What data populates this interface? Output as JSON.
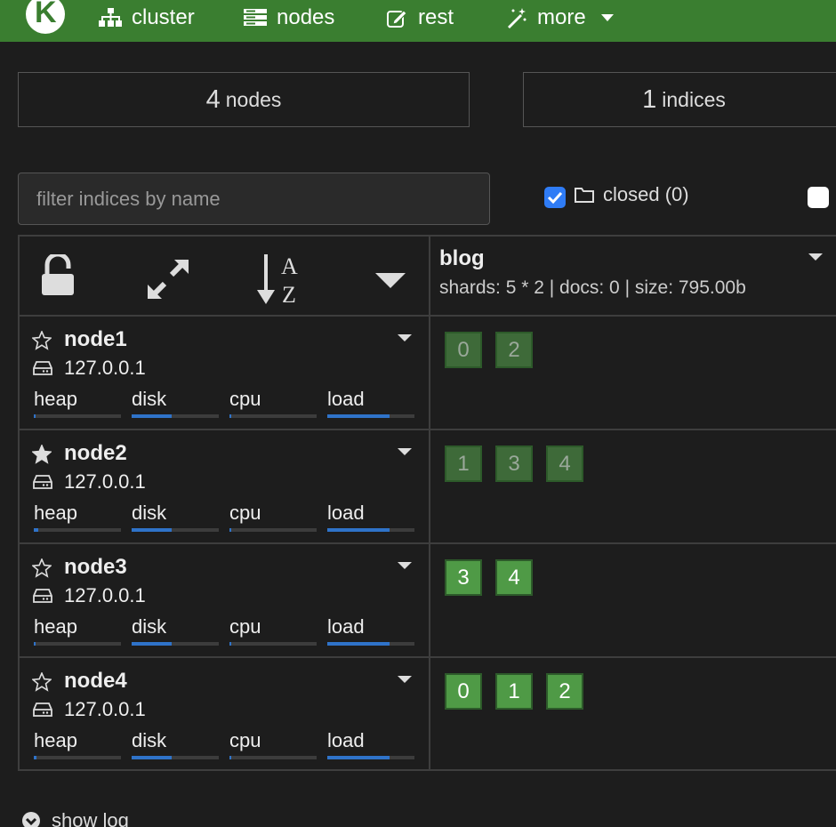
{
  "nav": {
    "logo_letter": "K",
    "items": [
      {
        "label": "cluster",
        "icon": "sitemap-icon"
      },
      {
        "label": "nodes",
        "icon": "server-icon"
      },
      {
        "label": "rest",
        "icon": "edit-icon"
      },
      {
        "label": "more",
        "icon": "magic-wand-icon"
      }
    ]
  },
  "summary": {
    "nodes": {
      "count": "4",
      "label": "nodes"
    },
    "indices": {
      "count": "1",
      "label": "indices"
    }
  },
  "filter": {
    "placeholder": "filter indices by name",
    "value": ""
  },
  "closed_filter": {
    "label": "closed (0)",
    "checked": true
  },
  "index": {
    "name": "blog",
    "stats": "shards: 5 * 2 | docs: 0 | size: 795.00b"
  },
  "metric_labels": {
    "heap": "heap",
    "disk": "disk",
    "cpu": "cpu",
    "load": "load"
  },
  "nodes": [
    {
      "name": "node1",
      "ip": "127.0.0.1",
      "master": false,
      "metrics": {
        "heap": 0.02,
        "disk": 0.46,
        "cpu": 0.02,
        "load": 0.71
      },
      "shards": [
        {
          "id": "0",
          "type": "replica"
        },
        {
          "id": "2",
          "type": "replica"
        }
      ]
    },
    {
      "name": "node2",
      "ip": "127.0.0.1",
      "master": true,
      "metrics": {
        "heap": 0.05,
        "disk": 0.46,
        "cpu": 0.0,
        "load": 0.71
      },
      "shards": [
        {
          "id": "1",
          "type": "replica"
        },
        {
          "id": "3",
          "type": "replica"
        },
        {
          "id": "4",
          "type": "replica"
        }
      ]
    },
    {
      "name": "node3",
      "ip": "127.0.0.1",
      "master": false,
      "metrics": {
        "heap": 0.02,
        "disk": 0.46,
        "cpu": 0.0,
        "load": 0.71
      },
      "shards": [
        {
          "id": "3",
          "type": "primary"
        },
        {
          "id": "4",
          "type": "primary"
        }
      ]
    },
    {
      "name": "node4",
      "ip": "127.0.0.1",
      "master": false,
      "metrics": {
        "heap": 0.03,
        "disk": 0.46,
        "cpu": 0.0,
        "load": 0.71
      },
      "shards": [
        {
          "id": "0",
          "type": "primary"
        },
        {
          "id": "1",
          "type": "primary"
        },
        {
          "id": "2",
          "type": "primary"
        }
      ]
    }
  ],
  "show_log": {
    "label": "show log"
  },
  "colors": {
    "navbar": "#3a7e30",
    "primary_shard": "#4f9a46",
    "replica_shard": "#3e6a39",
    "bar_fill": "#2f73c9",
    "checkbox": "#2f7cf6"
  }
}
